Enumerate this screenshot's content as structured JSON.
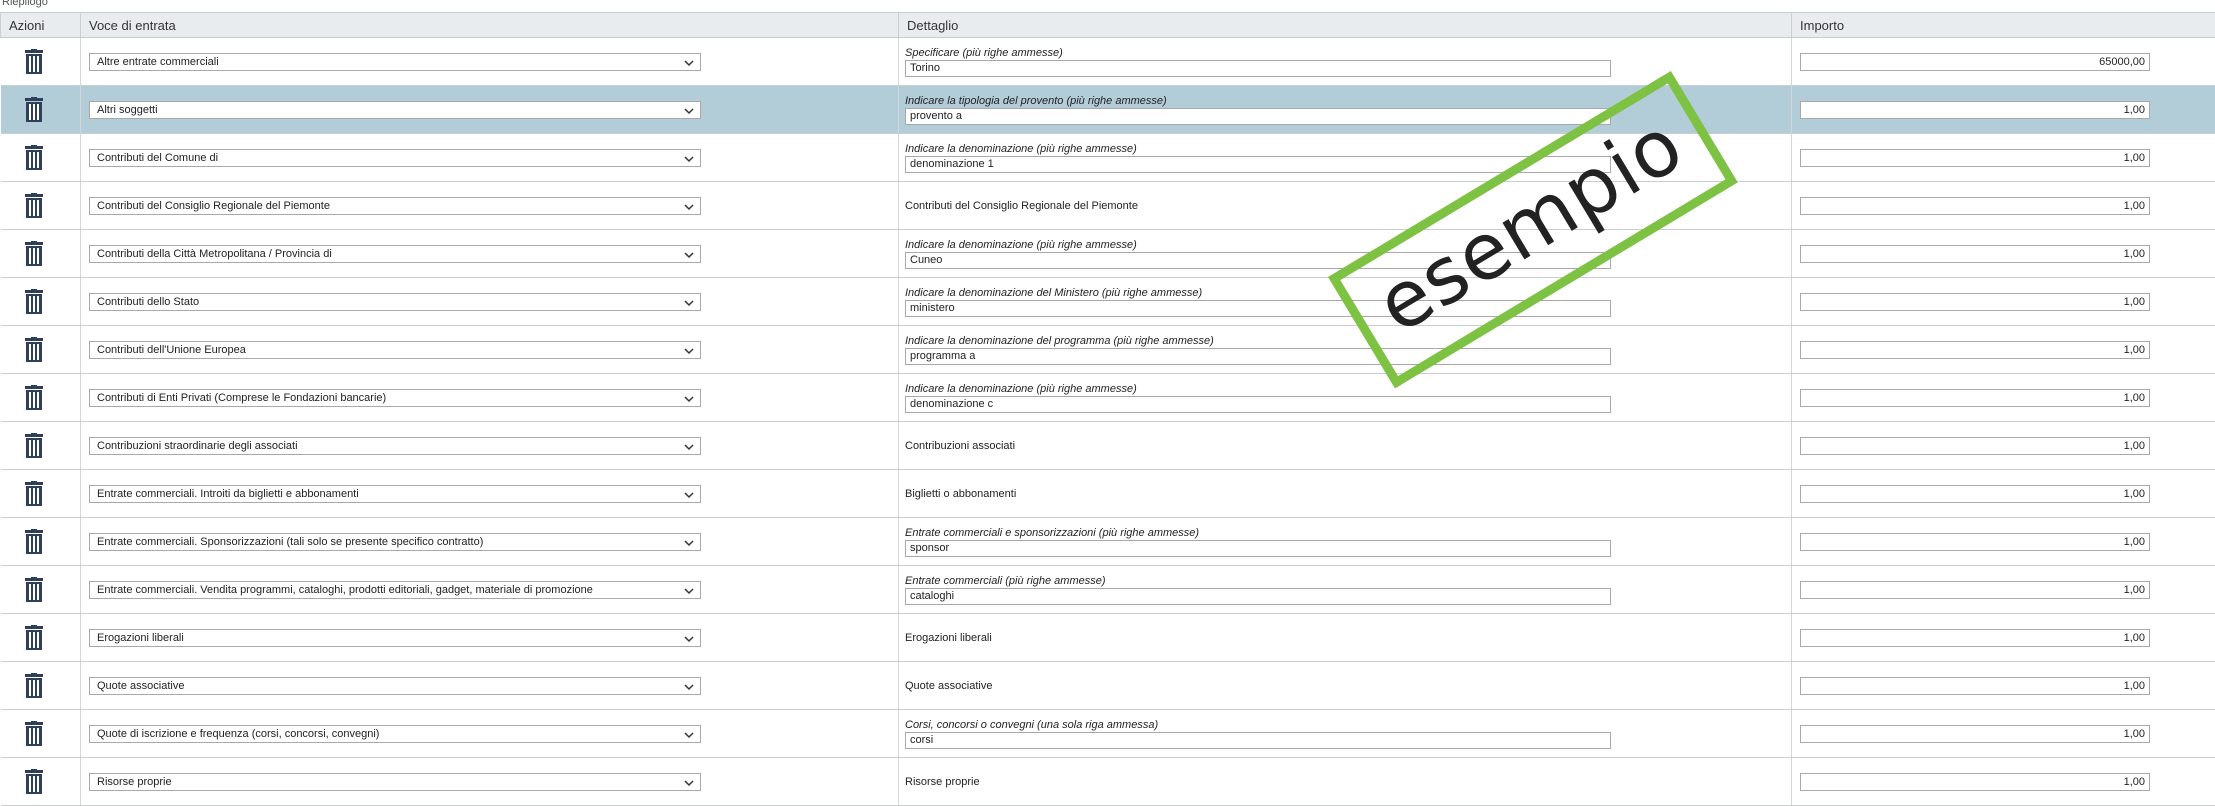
{
  "header_strip": "Riepilogo",
  "table": {
    "headers": {
      "actions": "Azioni",
      "entry": "Voce di entrata",
      "detail": "Dettaglio",
      "amount": "Importo"
    },
    "rows": [
      {
        "entry": "Altre entrate commerciali",
        "detail_label": "Specificare (più righe ammesse)",
        "detail_value": "Torino",
        "has_input": true,
        "amount": "65000,00",
        "selected": false
      },
      {
        "entry": "Altri soggetti",
        "detail_label": "Indicare la tipologia del provento (più righe ammesse)",
        "detail_value": "provento a",
        "has_input": true,
        "amount": "1,00",
        "selected": true
      },
      {
        "entry": "Contributi del Comune di",
        "detail_label": "Indicare la denominazione (più righe ammesse)",
        "detail_value": "denominazione 1",
        "has_input": true,
        "amount": "1,00",
        "selected": false
      },
      {
        "entry": "Contributi del Consiglio Regionale del Piemonte",
        "detail_label": "Contributi del Consiglio Regionale del Piemonte",
        "detail_value": "",
        "has_input": false,
        "amount": "1,00",
        "selected": false
      },
      {
        "entry": "Contributi della Città Metropolitana / Provincia di",
        "detail_label": "Indicare la denominazione (più righe ammesse)",
        "detail_value": "Cuneo",
        "has_input": true,
        "amount": "1,00",
        "selected": false
      },
      {
        "entry": "Contributi dello Stato",
        "detail_label": "Indicare la denominazione del Ministero (più righe ammesse)",
        "detail_value": "ministero",
        "has_input": true,
        "amount": "1,00",
        "selected": false
      },
      {
        "entry": "Contributi dell'Unione Europea",
        "detail_label": "Indicare la denominazione del programma (più righe ammesse)",
        "detail_value": "programma a",
        "has_input": true,
        "amount": "1,00",
        "selected": false
      },
      {
        "entry": "Contributi di Enti Privati (Comprese le Fondazioni bancarie)",
        "detail_label": "Indicare la denominazione (più righe ammesse)",
        "detail_value": "denominazione c",
        "has_input": true,
        "amount": "1,00",
        "selected": false
      },
      {
        "entry": "Contribuzioni straordinarie degli associati",
        "detail_label": "Contribuzioni associati",
        "detail_value": "",
        "has_input": false,
        "amount": "1,00",
        "selected": false
      },
      {
        "entry": "Entrate commerciali. Introiti da biglietti e abbonamenti",
        "detail_label": "Biglietti o abbonamenti",
        "detail_value": "",
        "has_input": false,
        "amount": "1,00",
        "selected": false
      },
      {
        "entry": "Entrate commerciali. Sponsorizzazioni (tali solo se presente specifico contratto)",
        "detail_label": "Entrate commerciali e sponsorizzazioni (più righe ammesse)",
        "detail_value": "sponsor",
        "has_input": true,
        "amount": "1,00",
        "selected": false
      },
      {
        "entry": "Entrate commerciali. Vendita programmi, cataloghi, prodotti editoriali, gadget, materiale di promozione",
        "detail_label": "Entrate commerciali (più righe ammesse)",
        "detail_value": "cataloghi",
        "has_input": true,
        "amount": "1,00",
        "selected": false
      },
      {
        "entry": "Erogazioni liberali",
        "detail_label": "Erogazioni liberali",
        "detail_value": "",
        "has_input": false,
        "amount": "1,00",
        "selected": false
      },
      {
        "entry": "Quote associative",
        "detail_label": "Quote associative",
        "detail_value": "",
        "has_input": false,
        "amount": "1,00",
        "selected": false
      },
      {
        "entry": "Quote di iscrizione e frequenza (corsi, concorsi, convegni)",
        "detail_label": "Corsi, concorsi o convegni (una sola riga ammessa)",
        "detail_value": "corsi",
        "has_input": true,
        "amount": "1,00",
        "selected": false
      },
      {
        "entry": "Risorse proprie",
        "detail_label": "Risorse proprie",
        "detail_value": "",
        "has_input": false,
        "amount": "1,00",
        "selected": false
      }
    ]
  },
  "stamp": {
    "text": "esempio",
    "color": "#7dc242"
  },
  "colors": {
    "selected_row": "#b2ccd8",
    "header_bg": "#e9ecef",
    "trash_icon": "#2e3f5c"
  },
  "icons": {
    "row_action": "trash-icon",
    "select_arrow": "chevron-down-icon"
  }
}
